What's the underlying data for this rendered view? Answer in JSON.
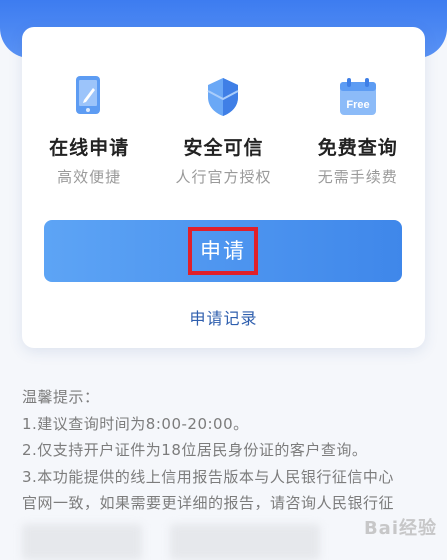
{
  "features": [
    {
      "icon": "phone-edit-icon",
      "title": "在线申请",
      "subtitle": "高效便捷"
    },
    {
      "icon": "shield-icon",
      "title": "安全可信",
      "subtitle": "人行官方授权"
    },
    {
      "icon": "free-calendar-icon",
      "icon_text": "Free",
      "title": "免费查询",
      "subtitle": "无需手续费"
    }
  ],
  "apply_button": {
    "label": "申请"
  },
  "records_link": {
    "label": "申请记录"
  },
  "tips": {
    "heading": "温馨提示：",
    "items": [
      "1.建议查询时间为8:00-20:00。",
      "2.仅支持开户证件为18位居民身份证的客户查询。",
      "3.本功能提供的线上信用报告版本与人民银行征信中心",
      "官网一致，如果需要更详细的报告，请咨询人民银行征"
    ]
  },
  "watermark": {
    "text": "Bai经验"
  },
  "colors": {
    "accent": "#3f87ea",
    "highlight_border": "#e0202a",
    "link": "#2f5fae"
  }
}
